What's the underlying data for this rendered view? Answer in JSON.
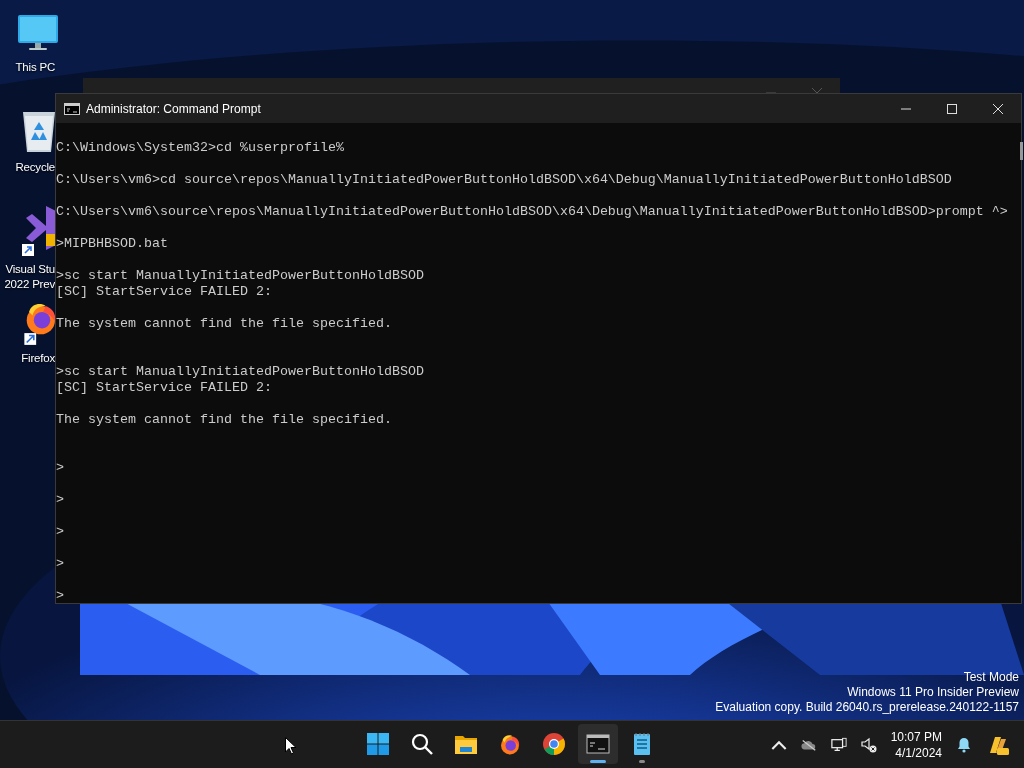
{
  "desktop_icons": [
    {
      "kind": "monitor",
      "label_lines": [
        "This PC"
      ]
    },
    {
      "kind": "recycle",
      "label_lines": [
        "Recycle"
      ]
    },
    {
      "kind": "studio",
      "label_lines": [
        "Visual Stu",
        "2022 Prev"
      ]
    },
    {
      "kind": "firefox",
      "label_lines": [
        "Firefox"
      ]
    }
  ],
  "window": {
    "title": "Administrator: Command Prompt",
    "lines": [
      {
        "kind": "text",
        "text": "C:\\Windows\\System32>cd %userprofile%"
      },
      {
        "kind": "blank"
      },
      {
        "kind": "text",
        "text": "C:\\Users\\vm6>cd source\\repos\\ManuallyInitiatedPowerButtonHoldBSOD\\x64\\Debug\\ManuallyInitiatedPowerButtonHoldBSOD"
      },
      {
        "kind": "blank"
      },
      {
        "kind": "text",
        "text": "C:\\Users\\vm6\\source\\repos\\ManuallyInitiatedPowerButtonHoldBSOD\\x64\\Debug\\ManuallyInitiatedPowerButtonHoldBSOD>prompt ^>"
      },
      {
        "kind": "blank"
      },
      {
        "kind": "text",
        "text": ">MIPBHBSOD.bat"
      },
      {
        "kind": "blank"
      },
      {
        "kind": "text",
        "text": ">sc start ManuallyInitiatedPowerButtonHoldBSOD"
      },
      {
        "kind": "text",
        "text": "[SC] StartService FAILED 2:"
      },
      {
        "kind": "blank"
      },
      {
        "kind": "text",
        "text": "The system cannot find the file specified."
      },
      {
        "kind": "blank"
      },
      {
        "kind": "blank"
      },
      {
        "kind": "text",
        "text": ">sc start ManuallyInitiatedPowerButtonHoldBSOD"
      },
      {
        "kind": "text",
        "text": "[SC] StartService FAILED 2:"
      },
      {
        "kind": "blank"
      },
      {
        "kind": "text",
        "text": "The system cannot find the file specified."
      },
      {
        "kind": "blank"
      },
      {
        "kind": "blank"
      },
      {
        "kind": "text",
        "text": ">"
      },
      {
        "kind": "blank"
      },
      {
        "kind": "text",
        "text": ">"
      },
      {
        "kind": "blank"
      },
      {
        "kind": "text",
        "text": ">"
      },
      {
        "kind": "blank"
      },
      {
        "kind": "text",
        "text": ">"
      },
      {
        "kind": "blank"
      },
      {
        "kind": "text",
        "text": ">"
      }
    ]
  },
  "watermark": [
    "Test Mode",
    "Windows 11 Pro Insider Preview",
    "Evaluation copy. Build 26040.rs_prerelease.240122-1157"
  ],
  "taskbar": {
    "apps": [
      {
        "kind": "start",
        "selected": false,
        "running": false
      },
      {
        "kind": "search",
        "selected": false,
        "running": false
      },
      {
        "kind": "folder",
        "selected": false,
        "running": false
      },
      {
        "kind": "firefox",
        "selected": false,
        "running": false
      },
      {
        "kind": "chrome",
        "selected": false,
        "running": false
      },
      {
        "kind": "terminal",
        "selected": true,
        "running": true
      },
      {
        "kind": "notepad",
        "selected": false,
        "running": true
      }
    ],
    "tray": {
      "time": "10:07 PM",
      "date": "4/1/2024"
    }
  }
}
